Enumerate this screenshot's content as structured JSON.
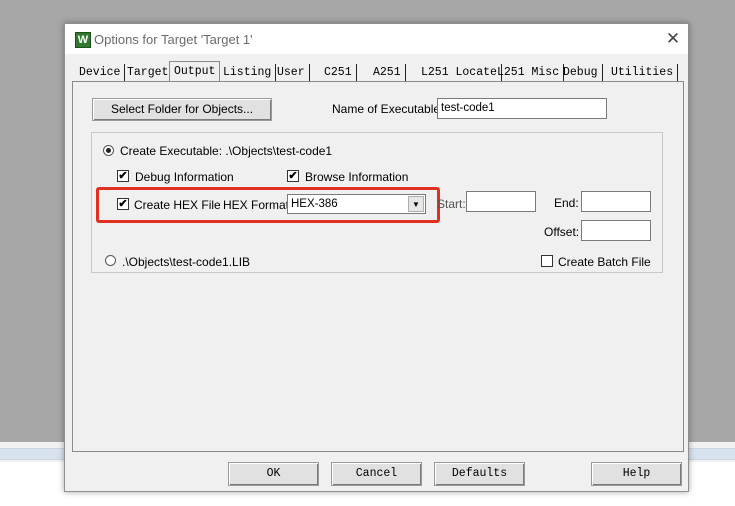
{
  "window": {
    "title": "Options for Target 'Target 1'",
    "app_icon_letter": "W",
    "close_glyph": "✕"
  },
  "tabs": [
    {
      "label": "Device"
    },
    {
      "label": "Target"
    },
    {
      "label": "Output",
      "active": true
    },
    {
      "label": "Listing"
    },
    {
      "label": "User"
    },
    {
      "label": "C251"
    },
    {
      "label": "A251"
    },
    {
      "label": "L251 Locate"
    },
    {
      "label": "L251 Misc"
    },
    {
      "label": "Debug"
    },
    {
      "label": "Utilities"
    }
  ],
  "output": {
    "select_folder_button": "Select Folder for Objects...",
    "name_label": "Name of Executable:",
    "name_value": "test-code1",
    "create_exe_label": "Create Executable:  .\\Objects\\test-code1",
    "create_exe_selected": true,
    "debug_info_label": "Debug Information",
    "debug_info_checked": true,
    "browse_info_label": "Browse Information",
    "browse_info_checked": true,
    "create_hex_label": "Create HEX File",
    "create_hex_checked": true,
    "hex_format_label": "HEX Format:",
    "hex_format_value": "HEX-386",
    "start_label": "Start:",
    "start_value": "",
    "end_label": "End:",
    "end_value": "",
    "offset_label": "Offset:",
    "offset_value": "",
    "lib_label": ".\\Objects\\test-code1.LIB",
    "lib_selected": false,
    "batch_label": "Create Batch File",
    "batch_checked": false
  },
  "footer": {
    "ok": "OK",
    "cancel": "Cancel",
    "defaults": "Defaults",
    "help": "Help"
  },
  "colors": {
    "highlight": "#e03020",
    "dialog_bg": "#f0f0f0",
    "desktop_bg": "#a7a7a7"
  },
  "glyphs": {
    "check": "✔",
    "dropdown": "▼"
  }
}
